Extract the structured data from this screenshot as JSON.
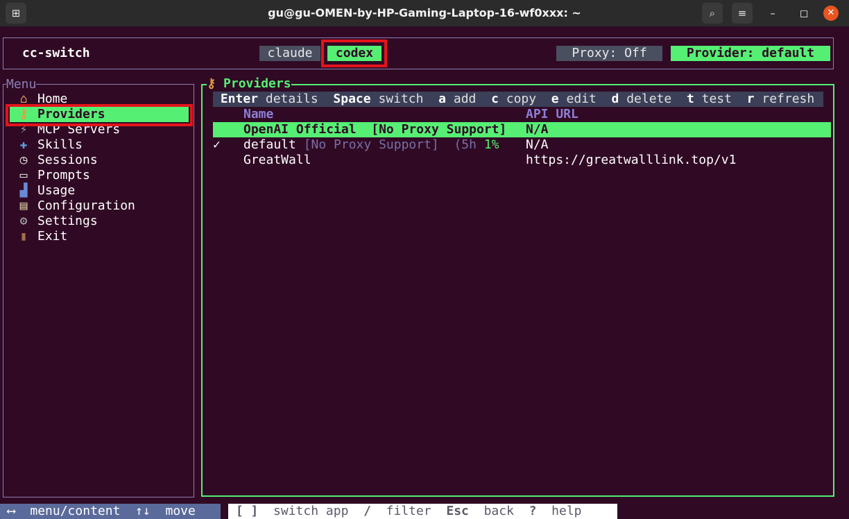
{
  "window": {
    "title": "gu@gu-OMEN-by-HP-Gaming-Laptop-16-wf0xxx: ~"
  },
  "header": {
    "app_name": "cc-switch",
    "tabs": [
      "claude",
      "codex"
    ],
    "active_tab": "codex",
    "proxy_status": "Proxy: Off",
    "provider_status": "Provider: default"
  },
  "menu": {
    "title": "Menu",
    "items": [
      {
        "label": "Home",
        "icon": "home-icon"
      },
      {
        "label": "Providers",
        "icon": "key-icon"
      },
      {
        "label": "MCP Servers",
        "icon": "plug-icon"
      },
      {
        "label": "Skills",
        "icon": "puzzle-icon"
      },
      {
        "label": "Sessions",
        "icon": "clock-icon"
      },
      {
        "label": "Prompts",
        "icon": "speech-bubble-icon"
      },
      {
        "label": "Usage",
        "icon": "bar-chart-icon"
      },
      {
        "label": "Configuration",
        "icon": "clipboard-icon"
      },
      {
        "label": "Settings",
        "icon": "wrench-icon"
      },
      {
        "label": "Exit",
        "icon": "door-icon"
      }
    ],
    "selected": "Providers"
  },
  "content": {
    "title": "Providers",
    "keybinds": [
      {
        "key": "Enter",
        "action": "details"
      },
      {
        "key": "Space",
        "action": "switch"
      },
      {
        "key": "a",
        "action": "add"
      },
      {
        "key": "c",
        "action": "copy"
      },
      {
        "key": "e",
        "action": "edit"
      },
      {
        "key": "d",
        "action": "delete"
      },
      {
        "key": "t",
        "action": "test"
      },
      {
        "key": "r",
        "action": "refresh"
      }
    ],
    "columns": [
      "Name",
      "API URL"
    ],
    "rows": [
      {
        "mark": "",
        "name": "OpenAI Official",
        "tag": "[No Proxy Support]",
        "extra": "",
        "extra_pct": "",
        "url": "N/A"
      },
      {
        "mark": "✓",
        "name": "default",
        "tag": "[No Proxy Support]",
        "extra": "(5h",
        "extra_pct": "1%",
        "url": "N/A"
      },
      {
        "mark": "",
        "name": "GreatWall",
        "tag": "",
        "extra": "",
        "extra_pct": "",
        "url": "https://greatwalllink.top/v1"
      }
    ]
  },
  "footer": {
    "left": [
      {
        "key": "⟷",
        "action": "menu/content"
      },
      {
        "key": "↑↓",
        "action": "move"
      }
    ],
    "right": [
      {
        "key": "[ ]",
        "action": "switch app"
      },
      {
        "key": "/",
        "action": "filter"
      },
      {
        "key": "Esc",
        "action": "back"
      },
      {
        "key": "?",
        "action": "help"
      }
    ]
  },
  "colors": {
    "accent": "#55ef74",
    "background": "#300a24",
    "highlight": "#e4141b"
  }
}
